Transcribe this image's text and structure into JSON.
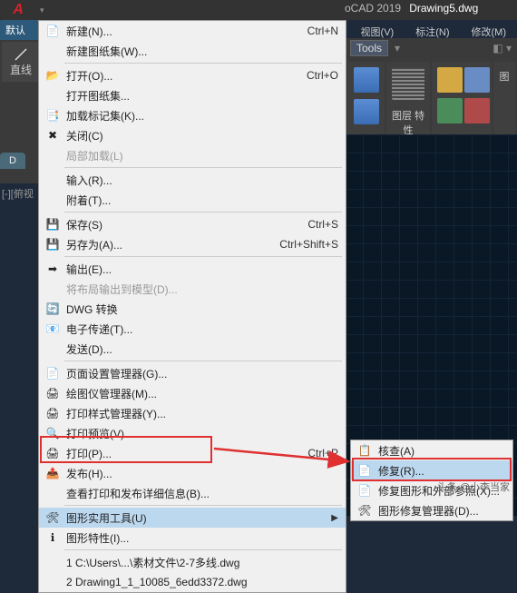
{
  "app": {
    "name": "oCAD 2019",
    "file": "Drawing5.dwg",
    "logo": "A"
  },
  "title_tabs": {
    "view": "视图(V)",
    "annotate": "标注(N)",
    "modify": "修改(M)"
  },
  "ribbon": {
    "tools": "Tools",
    "layers": "图层\n特性",
    "group": "图"
  },
  "left": {
    "default": "默认",
    "line": "直线",
    "tab": "D"
  },
  "side": "[-][俯视",
  "menu": {
    "new": "新建(N)...",
    "new_sheetset": "新建图纸集(W)...",
    "open": "打开(O)...",
    "open_sheetset": "打开图纸集...",
    "load_markup": "加载标记集(K)...",
    "close": "关闭(C)",
    "partial_load": "局部加载(L)",
    "import": "输入(R)...",
    "attach": "附着(T)...",
    "save": "保存(S)",
    "save_as": "另存为(A)...",
    "export": "输出(E)...",
    "export_layout": "将布局输出到模型(D)...",
    "dwg_convert": "DWG 转换",
    "etransmit": "电子传递(T)...",
    "send": "发送(D)...",
    "page_setup": "页面设置管理器(G)...",
    "plotter_mgr": "绘图仪管理器(M)...",
    "plot_style": "打印样式管理器(Y)...",
    "plot_preview": "打印预览(V)...",
    "plot": "打印(P)...",
    "publish": "发布(H)...",
    "plot_details": "查看打印和发布详细信息(B)...",
    "utilities": "图形实用工具(U)",
    "properties": "图形特性(I)...",
    "recent1": "1 C:\\Users\\...\\素材文件\\2-7多线.dwg",
    "recent2": "2 Drawing1_1_10085_6edd3372.dwg"
  },
  "shortcuts": {
    "new": "Ctrl+N",
    "open": "Ctrl+O",
    "save": "Ctrl+S",
    "save_as": "Ctrl+Shift+S",
    "plot": "Ctrl+P"
  },
  "submenu": {
    "audit": "核查(A)",
    "recover": "修复(R)...",
    "recover_xref": "修复图形和外部参照(X)...",
    "recovery_mgr": "图形修复管理器(D)..."
  },
  "watermark": "头条 @小李当家"
}
